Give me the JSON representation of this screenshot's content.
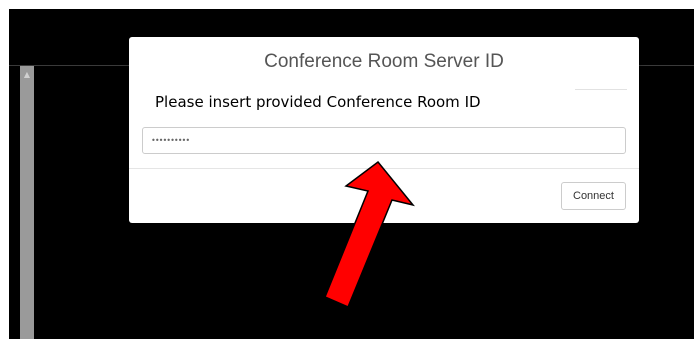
{
  "dialog": {
    "title": "Conference Room Server ID",
    "prompt": "Please insert provided Conference Room ID",
    "input_value": "••••••••••",
    "connect_label": "Connect"
  },
  "scrollbar": {
    "up_glyph": "▲"
  },
  "annotation": {
    "arrow_icon": "red-arrow-icon",
    "arrow_color": "#ff0000",
    "arrow_outline": "#000000"
  }
}
